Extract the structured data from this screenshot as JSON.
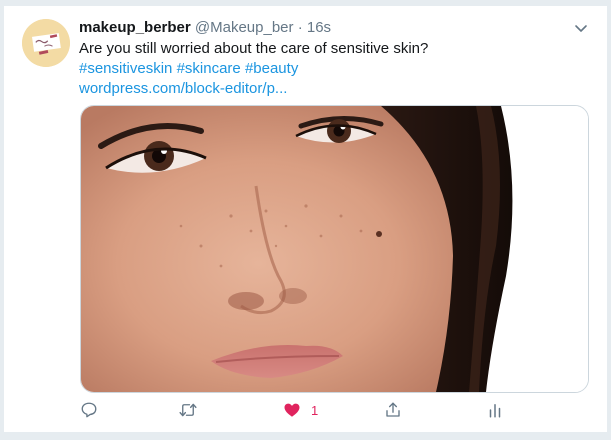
{
  "tweet": {
    "display_name": "makeup_berber",
    "handle": "@Makeup_ber",
    "separator": "·",
    "time": "16s",
    "text": "Are you still worried about the care of sensitive skin?",
    "hashtags": [
      "#sensitiveskin",
      "#skincare",
      "#beauty"
    ],
    "link_text": "wordpress.com/block-editor/p..."
  },
  "actions": {
    "reply_icon": "reply-icon",
    "retweet_icon": "retweet-icon",
    "like_icon": "heart-filled-icon",
    "like_count": "1",
    "share_icon": "share-icon",
    "analytics_icon": "analytics-icon"
  },
  "colors": {
    "background": "#e6ecf0",
    "text": "#14171a",
    "muted": "#657786",
    "link": "#1b95e0",
    "like": "#e0245e"
  }
}
